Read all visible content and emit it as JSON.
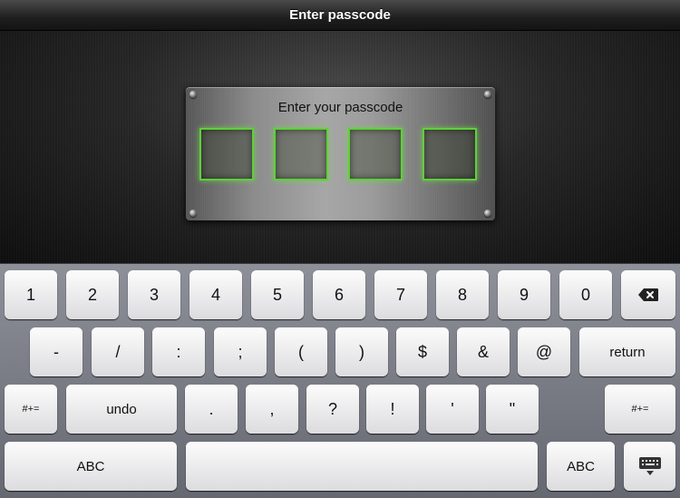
{
  "header": {
    "title": "Enter passcode"
  },
  "passcode_panel": {
    "prompt": "Enter your passcode",
    "digit_count": 4
  },
  "keyboard": {
    "row1": [
      "1",
      "2",
      "3",
      "4",
      "5",
      "6",
      "7",
      "8",
      "9",
      "0"
    ],
    "row2": [
      "-",
      "/",
      ":",
      ";",
      "(",
      ")",
      "$",
      "&",
      "@"
    ],
    "row2_return": "return",
    "row3_left_toggle": "#+=",
    "row3_undo": "undo",
    "row3": [
      ".",
      ",",
      "?",
      "!",
      "'",
      "\""
    ],
    "row3_right_toggle": "#+=",
    "row4_left": "ABC",
    "row4_right": "ABC",
    "icons": {
      "delete": "backspace-icon",
      "dismiss": "keyboard-dismiss-icon"
    }
  },
  "colors": {
    "digit_box_glow": "#5fcf3a"
  }
}
